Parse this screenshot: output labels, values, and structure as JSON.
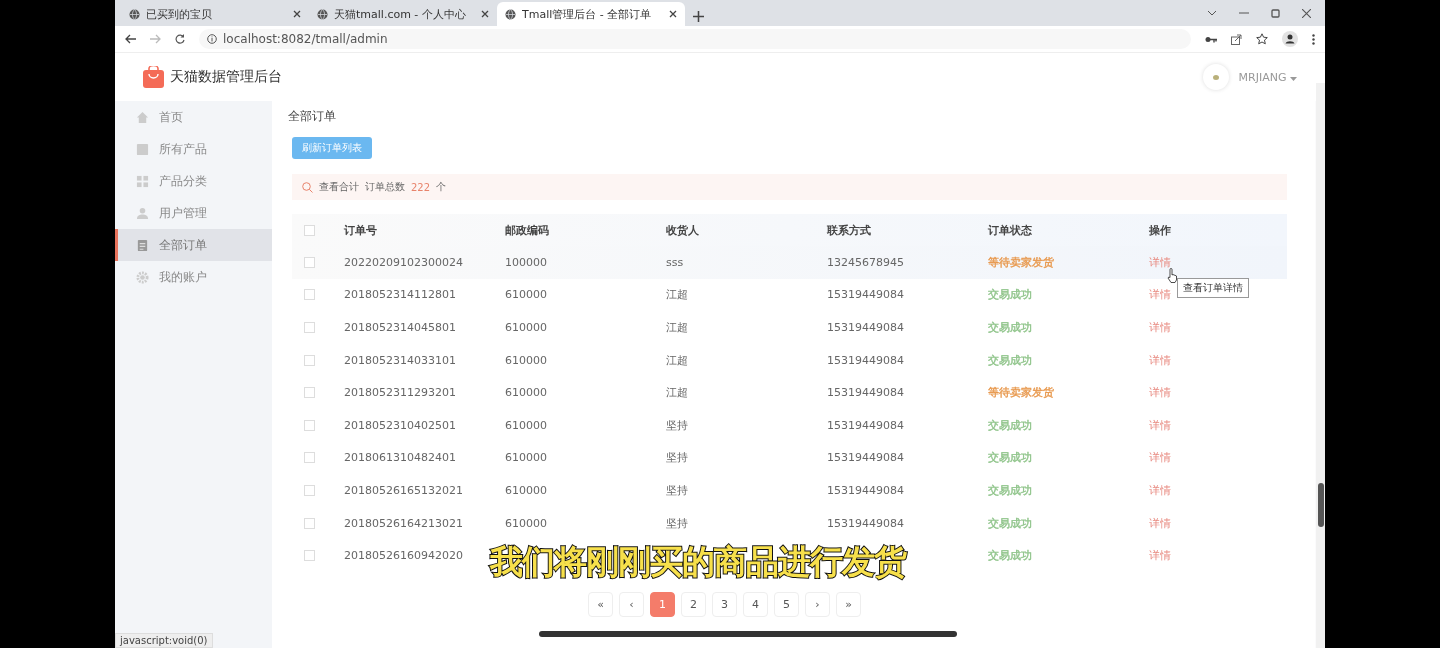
{
  "browser": {
    "tabs": [
      {
        "title": "已买到的宝贝",
        "selected": false
      },
      {
        "title": "天猫tmall.com - 个人中心",
        "selected": false
      },
      {
        "title": "Tmall管理后台 - 全部订单",
        "selected": true
      }
    ],
    "address": "localhost:8082/tmall/admin",
    "status_text": "javascript:void(0)"
  },
  "header": {
    "brand": "天猫数据管理后台",
    "user": "MRJIANG"
  },
  "sidebar": {
    "items": [
      {
        "label": "首页",
        "kind": "home",
        "selected": false
      },
      {
        "label": "所有产品",
        "kind": "product",
        "selected": false
      },
      {
        "label": "产品分类",
        "kind": "category",
        "selected": false
      },
      {
        "label": "用户管理",
        "kind": "user",
        "selected": false
      },
      {
        "label": "全部订单",
        "kind": "order",
        "selected": true
      },
      {
        "label": "我的账户",
        "kind": "account",
        "selected": false
      }
    ]
  },
  "page": {
    "breadcrumb": "全部订单",
    "refresh_button": "刷新订单列表",
    "summary": {
      "label": "查看合计",
      "count_label": "订单总数",
      "count": "222",
      "unit": "个"
    }
  },
  "table": {
    "columns": [
      "订单号",
      "邮政编码",
      "收货人",
      "联系方式",
      "订单状态",
      "操作"
    ],
    "all_checked": false,
    "rows": [
      {
        "order_no": "20220209102300024",
        "zip": "100000",
        "receiver": "sss",
        "phone": "13245678945",
        "status": "等待卖家发货",
        "color": "#e89a50",
        "action": "详情",
        "checked": false,
        "highlighted": true
      },
      {
        "order_no": "2018052314112801",
        "zip": "610000",
        "receiver": "江超",
        "phone": "15319449084",
        "status": "交易成功",
        "color": "#8fc48a",
        "action": "详情",
        "checked": false,
        "highlighted": false
      },
      {
        "order_no": "2018052314045801",
        "zip": "610000",
        "receiver": "江超",
        "phone": "15319449084",
        "status": "交易成功",
        "color": "#8fc48a",
        "action": "详情",
        "checked": false,
        "highlighted": false
      },
      {
        "order_no": "2018052314033101",
        "zip": "610000",
        "receiver": "江超",
        "phone": "15319449084",
        "status": "交易成功",
        "color": "#8fc48a",
        "action": "详情",
        "checked": false,
        "highlighted": false
      },
      {
        "order_no": "2018052311293201",
        "zip": "610000",
        "receiver": "江超",
        "phone": "15319449084",
        "status": "等待卖家发货",
        "color": "#e89a50",
        "action": "详情",
        "checked": false,
        "highlighted": false
      },
      {
        "order_no": "2018052310402501",
        "zip": "610000",
        "receiver": "坚持",
        "phone": "15319449084",
        "status": "交易成功",
        "color": "#8fc48a",
        "action": "详情",
        "checked": false,
        "highlighted": false
      },
      {
        "order_no": "2018061310482401",
        "zip": "610000",
        "receiver": "坚持",
        "phone": "15319449084",
        "status": "交易成功",
        "color": "#8fc48a",
        "action": "详情",
        "checked": false,
        "highlighted": false
      },
      {
        "order_no": "20180526165132021",
        "zip": "610000",
        "receiver": "坚持",
        "phone": "15319449084",
        "status": "交易成功",
        "color": "#8fc48a",
        "action": "详情",
        "checked": false,
        "highlighted": false
      },
      {
        "order_no": "20180526164213021",
        "zip": "610000",
        "receiver": "坚持",
        "phone": "15319449084",
        "status": "交易成功",
        "color": "#8fc48a",
        "action": "详情",
        "checked": false,
        "highlighted": false
      },
      {
        "order_no": "20180526160942020",
        "status": "交易成功",
        "color": "#8fc48a",
        "action": "详情",
        "checked": false,
        "highlighted": false
      }
    ],
    "tooltip": "查看订单详情"
  },
  "pagination": [
    {
      "label": "«",
      "selected": false
    },
    {
      "label": "‹",
      "selected": false
    },
    {
      "label": "1",
      "selected": true
    },
    {
      "label": "2",
      "selected": false
    },
    {
      "label": "3",
      "selected": false
    },
    {
      "label": "4",
      "selected": false
    },
    {
      "label": "5",
      "selected": false
    },
    {
      "label": "›",
      "selected": false
    },
    {
      "label": "»",
      "selected": false
    }
  ],
  "subtitle": "我们将刚刚买的商品进行发货"
}
